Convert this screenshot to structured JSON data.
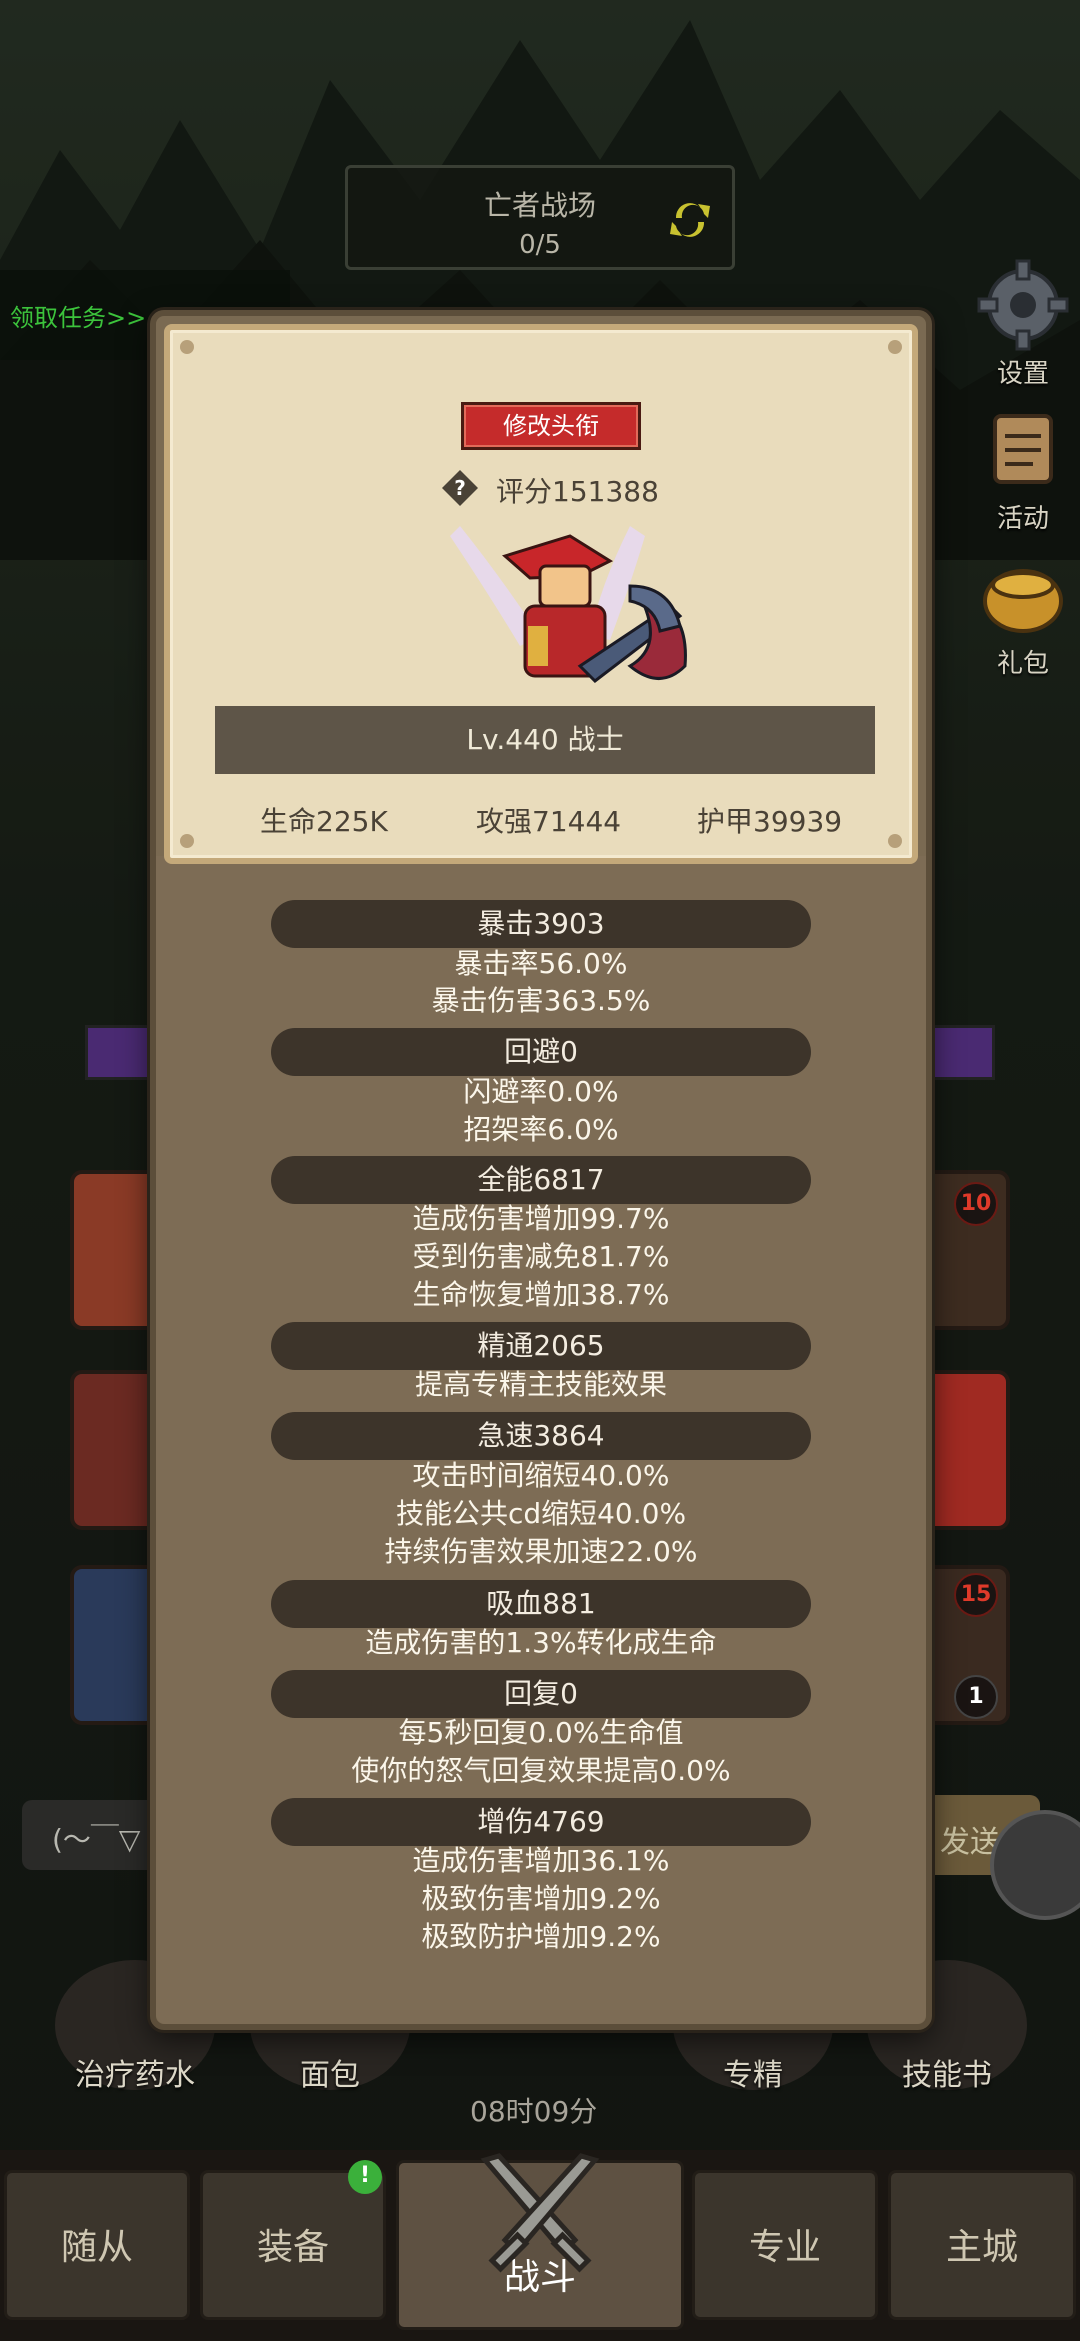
{
  "background": {
    "banner_title": "亡者战场",
    "banner_progress": "0/5",
    "task_link": "领取任务>>",
    "side_buttons": [
      {
        "label": "设置",
        "icon": "gear-icon"
      },
      {
        "label": "活动",
        "icon": "scroll-icon"
      },
      {
        "label": "礼包",
        "icon": "gift-pot-icon"
      }
    ],
    "slot_badges": [
      "10",
      "15",
      "1"
    ],
    "chat_placeholder": "(～￣▽",
    "send_label": "发送",
    "items": [
      "治疗药水",
      "面包",
      "专精",
      "技能书"
    ],
    "timer": "08时09分",
    "nav": [
      "随从",
      "装备",
      "战斗",
      "专业",
      "主城"
    ],
    "nav_badge": "!"
  },
  "panel": {
    "edit_title_button": "修改头衔",
    "score": "评分151388",
    "level": "Lv.440 战士",
    "stats": {
      "hp": "生命225K",
      "attack": "攻强71444",
      "armor": "护甲39939"
    },
    "sections": [
      {
        "title": "暴击3903",
        "lines": [
          "暴击率56.0%",
          "暴击伤害363.5%"
        ]
      },
      {
        "title": "回避0",
        "lines": [
          "闪避率0.0%",
          "招架率6.0%"
        ]
      },
      {
        "title": "全能6817",
        "lines": [
          "造成伤害增加99.7%",
          "受到伤害减免81.7%",
          "生命恢复增加38.7%"
        ]
      },
      {
        "title": "精通2065",
        "lines": [
          "提高专精主技能效果"
        ]
      },
      {
        "title": "急速3864",
        "lines": [
          "攻击时间缩短40.0%",
          "技能公共cd缩短40.0%",
          "持续伤害效果加速22.0%"
        ]
      },
      {
        "title": "吸血881",
        "lines": [
          "造成伤害的1.3%转化成生命"
        ]
      },
      {
        "title": "回复0",
        "lines": [
          "每5秒回复0.0%生命值",
          "使你的怒气回复效果提高0.0%"
        ]
      },
      {
        "title": "增伤4769",
        "lines": [
          "造成伤害增加36.1%",
          "极致伤害增加9.2%",
          "极致防护增加9.2%"
        ]
      }
    ]
  },
  "colors": {
    "title_button": "#c52b2b",
    "card_bg": "#e9dcbc",
    "panel_bg": "#7a6a52",
    "section_bar": "#3d342a",
    "task_green": "#3cc43c"
  }
}
